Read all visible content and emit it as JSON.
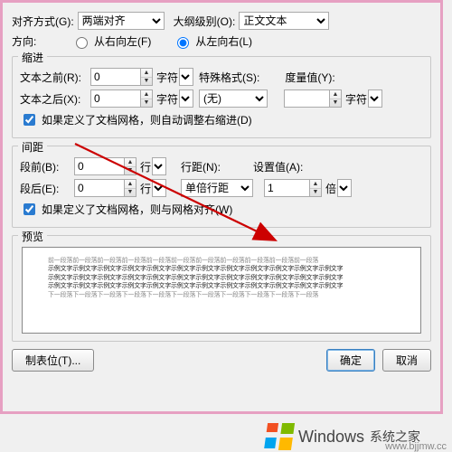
{
  "general": {
    "align_label": "对齐方式(G):",
    "align_value": "两端对齐",
    "outline_label": "大纲级别(O):",
    "outline_value": "正文文本",
    "direction_label": "方向:",
    "rtl_label": "从右向左(F)",
    "ltr_label": "从左向右(L)"
  },
  "indent": {
    "group_title": "缩进",
    "before_label": "文本之前(R):",
    "before_value": "0",
    "after_label": "文本之后(X):",
    "after_value": "0",
    "unit_char": "字符",
    "special_label": "特殊格式(S):",
    "special_value": "(无)",
    "measure_label": "度量值(Y):",
    "measure_value": "",
    "auto_chk_label": "如果定义了文档网格，则自动调整右缩进(D)"
  },
  "spacing": {
    "group_title": "间距",
    "before_label": "段前(B):",
    "before_value": "0",
    "after_label": "段后(E):",
    "after_value": "0",
    "unit_line": "行",
    "linespace_label": "行距(N):",
    "linespace_value": "单倍行距",
    "setval_label": "设置值(A):",
    "setval_value": "1",
    "unit_bei": "倍",
    "grid_chk_label": "如果定义了文档网格，则与网格对齐(W)"
  },
  "preview": {
    "group_title": "预览",
    "line1": "前一段落前一段落前一段落前一段落前一段落前一段落前一段落前一段落前一段落前一段落前一段落",
    "line2": "示例文字示例文字示例文字示例文字示例文字示例文字示例文字示例文字示例文字示例文字示例文字示例文字",
    "line3": "示例文字示例文字示例文字示例文字示例文字示例文字示例文字示例文字示例文字示例文字示例文字示例文字",
    "line4": "示例文字示例文字示例文字示例文字示例文字示例文字示例文字示例文字示例文字示例文字示例文字示例文字",
    "line5": "下一段落下一段落下一段落下一段落下一段落下一段落下一段落下一段落下一段落下一段落下一段落"
  },
  "buttons": {
    "tabs": "制表位(T)...",
    "ok": "确定",
    "cancel": "取消"
  },
  "footer": {
    "win": "Windows",
    "sub": "系统之家",
    "url": "www.bjjmw.cc"
  }
}
